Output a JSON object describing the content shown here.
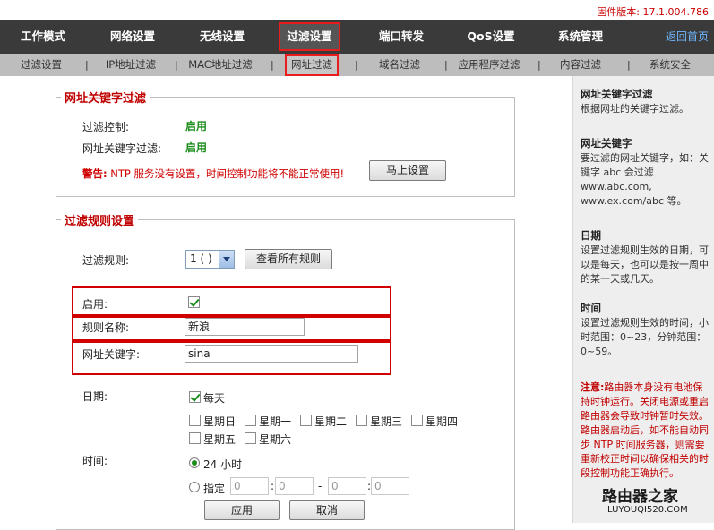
{
  "firmware": "固件版本: 17.1.004.786",
  "nav": {
    "items": [
      "工作模式",
      "网络设置",
      "无线设置",
      "过滤设置",
      "端口转发",
      "QoS设置",
      "系统管理"
    ],
    "home": "返回首页"
  },
  "subnav": {
    "items": [
      "过滤设置",
      "IP地址过滤",
      "MAC地址过滤",
      "网址过滤",
      "域名过滤",
      "应用程序过滤",
      "内容过滤",
      "系统安全"
    ]
  },
  "section1": {
    "legend": "网址关键字过滤",
    "control_label": "过滤控制:",
    "control_value": "启用",
    "keyword_label": "网址关键字过滤:",
    "keyword_value": "启用",
    "warning_prefix": "警告:",
    "warning_text": " NTP 服务没有设置，时间控制功能将不能正常使用!",
    "setup_button": "马上设置"
  },
  "section2": {
    "legend": "过滤规则设置",
    "rule_label": "过滤规则:",
    "rule_select": "1 ( )",
    "view_all_button": "查看所有规则",
    "enable_label": "启用:",
    "name_label": "规则名称:",
    "name_value": "新浪",
    "keyword_label": "网址关键字:",
    "keyword_value": "sina",
    "date_label": "日期:",
    "everyday_label": "每天",
    "days": [
      "星期日",
      "星期一",
      "星期二",
      "星期三",
      "星期四",
      "星期五",
      "星期六"
    ],
    "time_label": "时间:",
    "hours24_label": "24 小时",
    "custom_label": "指定",
    "time_inputs": [
      "0",
      "0",
      "0",
      "0"
    ],
    "time_sep": ":",
    "time_dash": "-",
    "apply_button": "应用",
    "cancel_button": "取消"
  },
  "help": {
    "t1": "网址关键字过滤",
    "d1": "根据网址的关键字过滤。",
    "t2": "网址关键字",
    "d2": "要过滤的网址关键字，如：关键字 abc 会过滤 www.abc.com, www.ex.com/abc 等。",
    "t3": "日期",
    "d3": "设置过滤规则生效的日期，可以是每天，也可以是按一周中的某一天或几天。",
    "t4": "时间",
    "d4": "设置过滤规则生效的时间，小时范围：0~23，分钟范围：0~59。",
    "note_prefix": "注意:",
    "note": "路由器本身没有电池保持时钟运行。关闭电源或重启路由器会导致时钟暂时失效。路由器启动后，如不能自动同步 NTP 时间服务器，则需要重新校正时间以确保相关的时段控制功能正确执行。"
  },
  "logo": {
    "main": "路由器之家",
    "sub": "LUYOUQI520.COM"
  }
}
